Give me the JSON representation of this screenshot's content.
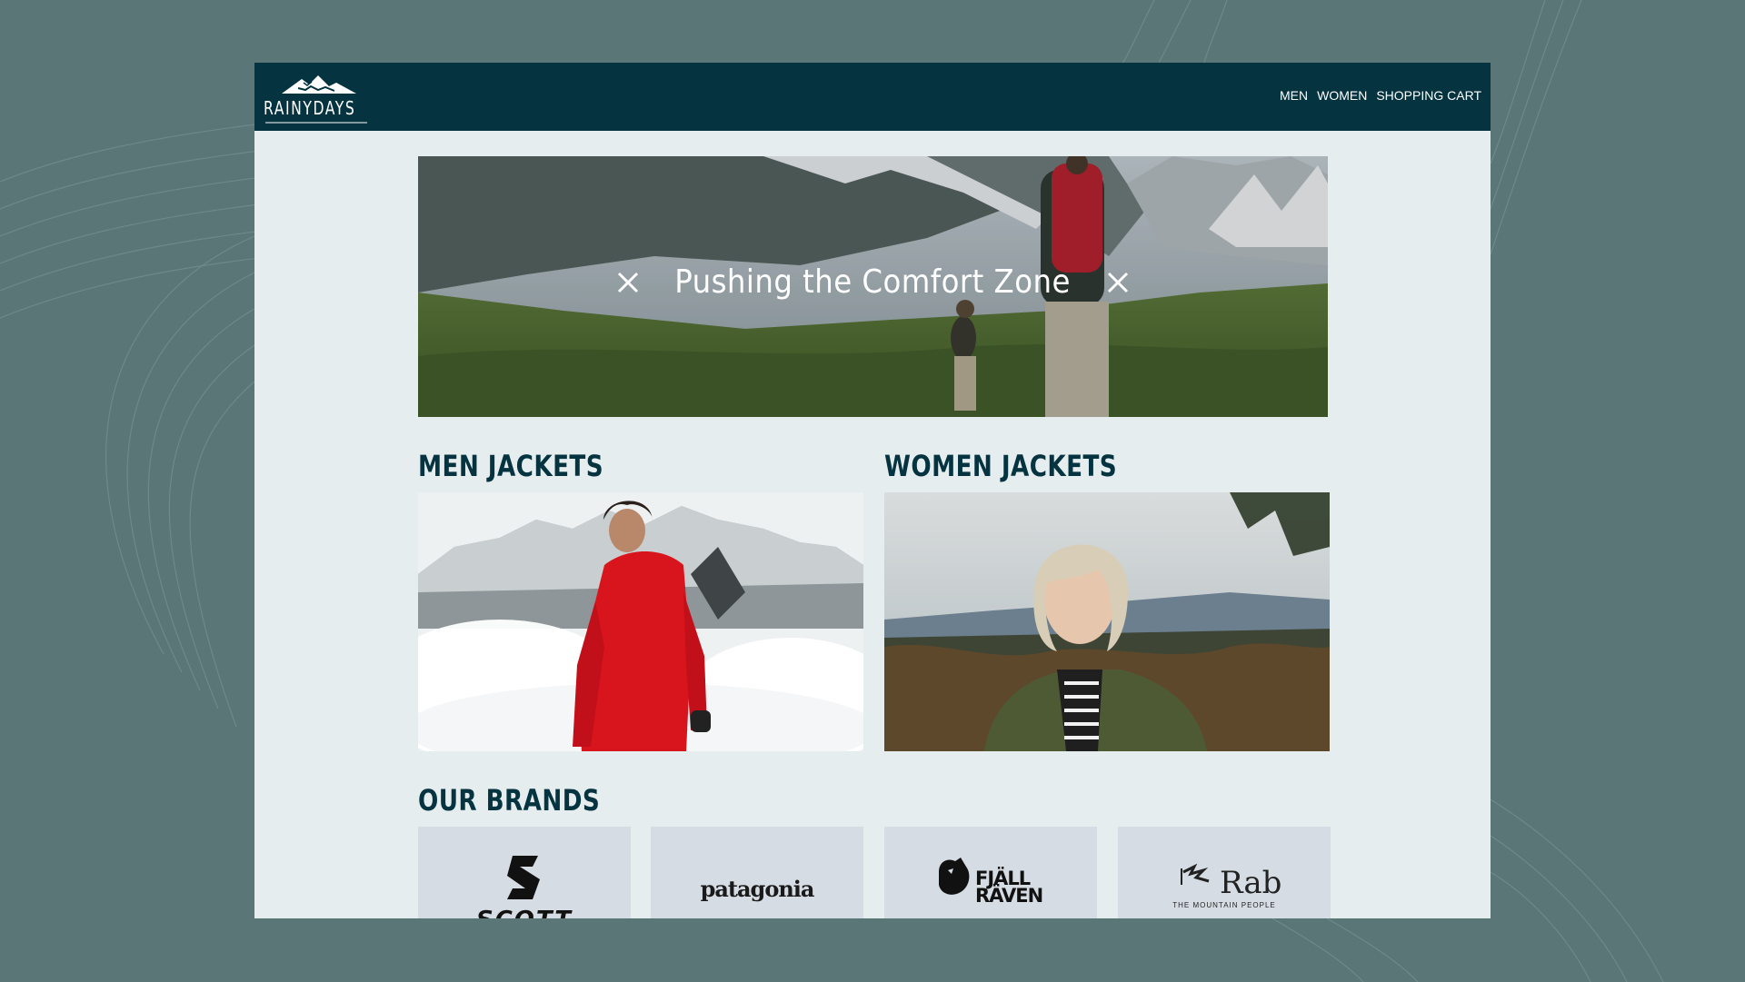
{
  "app": {
    "brand": "RAINYDAYS"
  },
  "nav": {
    "items": [
      {
        "label": "MEN"
      },
      {
        "label": "WOMEN"
      },
      {
        "label": "SHOPPING CART"
      }
    ]
  },
  "hero": {
    "title": "Pushing the Comfort Zone"
  },
  "sections": {
    "men": {
      "title": "MEN JACKETS"
    },
    "women": {
      "title": "WOMEN JACKETS"
    },
    "brands": {
      "title": "OUR BRANDS"
    }
  },
  "brands": [
    {
      "name": "SCOTT"
    },
    {
      "name": "patagonia"
    },
    {
      "name": "FJÄLL\nRÄVEN"
    },
    {
      "name": "Rab",
      "tagline": "THE MOUNTAIN PEOPLE"
    }
  ],
  "colors": {
    "page_background": "#5a7676",
    "navbar": "#053340",
    "content_background": "#e6edef",
    "heading": "#053340",
    "brand_card": "#d6dce3"
  }
}
